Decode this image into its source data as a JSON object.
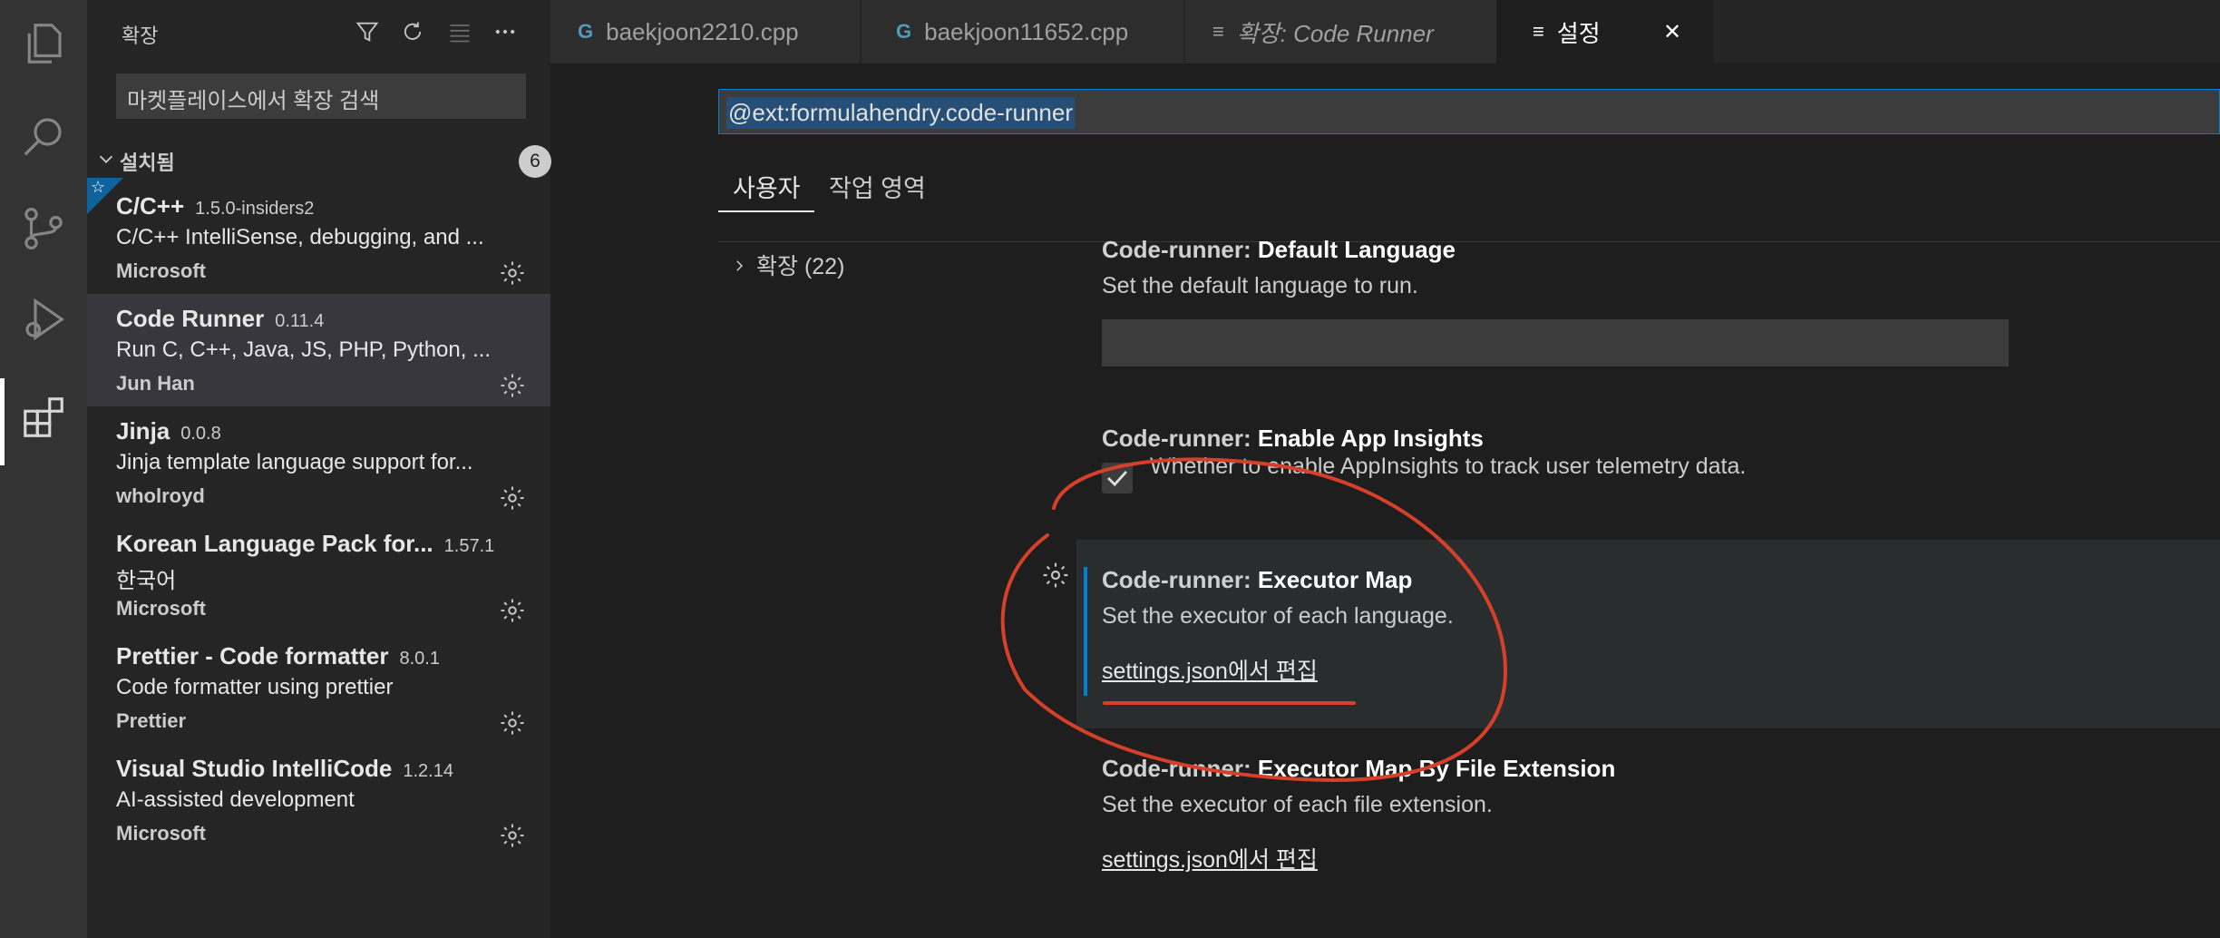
{
  "sidebar": {
    "title": "확장",
    "search_placeholder": "마켓플레이스에서 확장 검색",
    "installed_label": "설치됨",
    "installed_count": "6",
    "extensions": [
      {
        "name": "C/C++",
        "version": "1.5.0-insiders2",
        "description": "C/C++ IntelliSense, debugging, and ...",
        "publisher": "Microsoft"
      },
      {
        "name": "Code Runner",
        "version": "0.11.4",
        "description": "Run C, C++, Java, JS, PHP, Python, ...",
        "publisher": "Jun Han"
      },
      {
        "name": "Jinja",
        "version": "0.0.8",
        "description": "Jinja template language support for...",
        "publisher": "wholroyd"
      },
      {
        "name": "Korean Language Pack for...",
        "version": "1.57.1",
        "description": "한국어",
        "publisher": "Microsoft"
      },
      {
        "name": "Prettier - Code formatter",
        "version": "8.0.1",
        "description": "Code formatter using prettier",
        "publisher": "Prettier"
      },
      {
        "name": "Visual Studio IntelliCode",
        "version": "1.2.14",
        "description": "AI-assisted development",
        "publisher": "Microsoft"
      }
    ]
  },
  "tabs": [
    {
      "icon": "G",
      "label": "baekjoon2210.cpp"
    },
    {
      "icon": "G",
      "label": "baekjoon11652.cpp"
    },
    {
      "icon": "≡",
      "label": "확장: Code Runner"
    },
    {
      "icon": "≡",
      "label": "설정",
      "close": "✕"
    }
  ],
  "settings": {
    "search_value": "@ext:formulahendry.code-runner",
    "scope_tabs": [
      "사용자",
      "작업 영역"
    ],
    "toc_item": "확장 (22)",
    "items": [
      {
        "category": "Code-runner: ",
        "name": "Default Language",
        "description": "Set the default language to run."
      },
      {
        "category": "Code-runner: ",
        "name": "Enable App Insights",
        "description": "Whether to enable AppInsights to track user telemetry data."
      },
      {
        "category": "Code-runner: ",
        "name": "Executor Map",
        "description": "Set the executor of each language.",
        "link": "settings.json에서 편집"
      },
      {
        "category": "Code-runner: ",
        "name": "Executor Map By File Extension",
        "description": "Set the executor of each file extension.",
        "link": "settings.json에서 편집"
      }
    ]
  },
  "colors": {
    "accent": "#007fd4",
    "annotation": "#d6402a",
    "badge": "#0e639c"
  }
}
